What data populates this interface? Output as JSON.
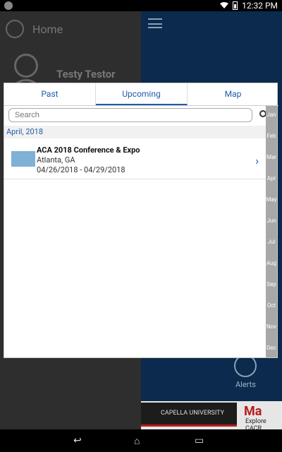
{
  "status": {
    "time": "12:32 PM"
  },
  "drawer": {
    "home_label": "Home",
    "user_name": "Testy Testor"
  },
  "main": {
    "alerts_label": "Alerts",
    "ad_text": "CAPELLA UNIVERSITY",
    "ad_side_text": "Ma",
    "ad_side_subtext": "Explore CACR"
  },
  "tabs": [
    {
      "label": "Past"
    },
    {
      "label": "Upcoming"
    },
    {
      "label": "Map"
    }
  ],
  "search": {
    "placeholder": "Search"
  },
  "section": {
    "label": "April, 2018"
  },
  "event": {
    "title": "ACA 2018 Conference & Expo",
    "location": "Atlanta, GA",
    "dates": "04/26/2018 - 04/29/2018"
  },
  "months": [
    "Jan",
    "Feb",
    "Mar",
    "Apr",
    "May",
    "Jun",
    "Jul",
    "Aug",
    "Sep",
    "Oct",
    "Nov",
    "Dec"
  ],
  "colors": {
    "accent": "#1f5da8",
    "drawer_bg": "#2e2e2e",
    "navy": "#0b2a4d"
  },
  "icons": [
    "home-icon",
    "avatar-icon",
    "menu-icon",
    "bell-icon",
    "search-icon",
    "chevron-right-icon",
    "wifi-icon",
    "battery-icon",
    "back-icon",
    "home-nav-icon",
    "recents-icon"
  ]
}
